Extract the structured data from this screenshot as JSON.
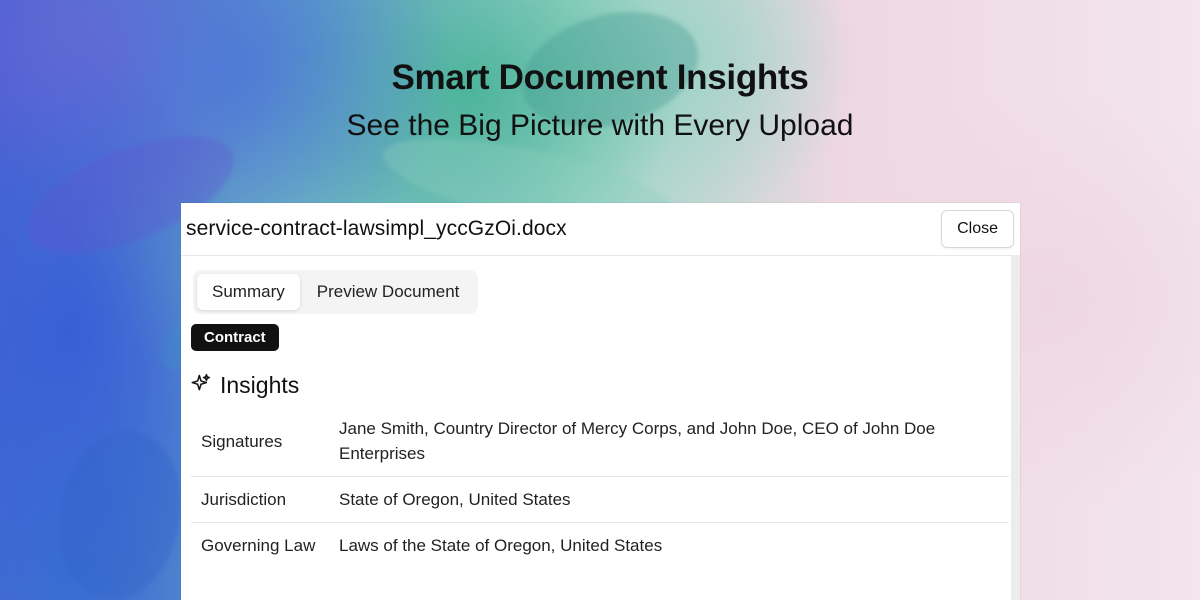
{
  "hero": {
    "title": "Smart Document Insights",
    "subtitle": "See the Big Picture with Every Upload"
  },
  "dialog": {
    "filename": "service-contract-lawsimpl_yccGzOi.docx",
    "close_label": "Close",
    "tabs": [
      {
        "label": "Summary",
        "active": true
      },
      {
        "label": "Preview Document",
        "active": false
      }
    ],
    "badge": "Contract",
    "insights": {
      "icon": "sparkle-icon",
      "title": "Insights",
      "rows": [
        {
          "key": "Signatures",
          "value": "Jane Smith, Country Director of Mercy Corps, and John Doe, CEO of John Doe Enterprises"
        },
        {
          "key": "Jurisdiction",
          "value": "State of Oregon, United States"
        },
        {
          "key": "Governing Law",
          "value": "Laws of the State of Oregon, United States"
        }
      ]
    }
  },
  "colors": {
    "badge_bg": "#111111",
    "panel_bg": "#ffffff",
    "page_pink": "#f3e4ec",
    "brush_blue": "#4a66d2",
    "brush_teal": "#4ab498"
  }
}
